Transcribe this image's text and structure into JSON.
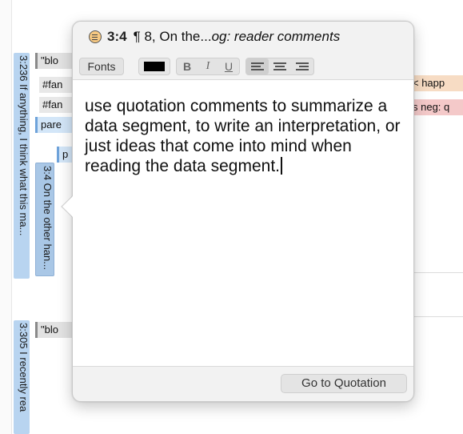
{
  "background": {
    "left_tabs": [
      {
        "label": "3:236 If anything, I think what this ma..."
      },
      {
        "label": "3:305 I recently rea"
      }
    ],
    "inner_tab": {
      "label": "3:4 On the other han..."
    },
    "chips": {
      "blo1": "\"blo",
      "fan1": "#fan",
      "fan2": "#fan",
      "pare": "pare",
      "p": "p",
      "blo2": "\"blo",
      "happ": "< happ",
      "neg": "s neg: q"
    }
  },
  "popover": {
    "title": {
      "icon": "quotation-comment-icon",
      "id": "3:4",
      "pilcrow": "¶",
      "paragraph": "8, On the...",
      "doc_italic": "og: reader comments"
    },
    "toolbar": {
      "fonts_label": "Fonts",
      "text_color": "#000000",
      "bold": "B",
      "italic": "I",
      "underline": "U",
      "align_selected": "left"
    },
    "comment_text": "use quotation comments to summarize a data segment, to write an interpretation, or just ideas that come into mind when reading the data segment.",
    "goto_label": "Go to Quotation"
  }
}
